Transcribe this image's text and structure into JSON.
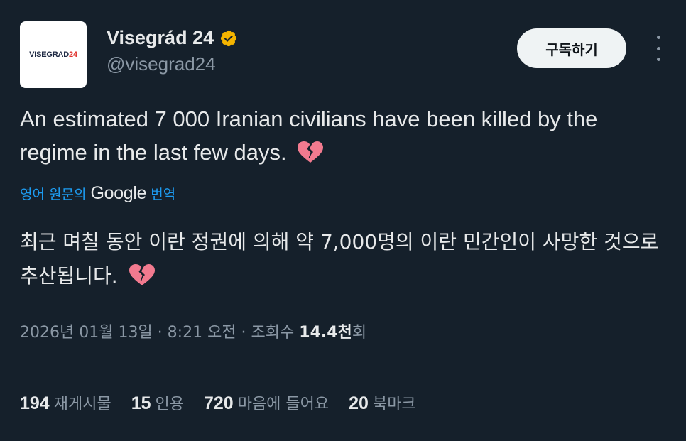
{
  "author": {
    "avatar_text_main": "VISEGRAD",
    "avatar_text_accent": "24",
    "display_name": "Visegrád 24",
    "handle": "@visegrad24",
    "verified_badge_color": "#f4b400"
  },
  "actions": {
    "subscribe_label": "구독하기",
    "more_icon": "more-vertical-icon"
  },
  "post": {
    "text_en": "An estimated 7 000 Iranian civilians have been killed by the regime in the last few days.",
    "emoji": "broken-heart-icon",
    "translation": {
      "prefix": "영어 원문의",
      "google": "Google",
      "suffix": "번역"
    },
    "text_ko": "최근 며칠 동안 이란 정권에 의해 약 7,000명의 이란 민간인이 사망한 것으로 추산됩니다."
  },
  "meta": {
    "date": "2026년 01월 13일",
    "sep1": " · ",
    "time": "8:21 오전",
    "sep2": " · ",
    "views_label": "조회수",
    "views_count": "14.4천",
    "views_suffix": "회"
  },
  "stats": {
    "reposts_count": "194",
    "reposts_label": "재게시물",
    "quotes_count": "15",
    "quotes_label": "인용",
    "likes_count": "720",
    "likes_label": "마음에 들어요",
    "bookmarks_count": "20",
    "bookmarks_label": "북마크"
  },
  "colors": {
    "background": "#15202b",
    "text_primary": "#e7e9ea",
    "text_secondary": "#8b98a5",
    "link": "#1d9bf0",
    "divider": "#38444d",
    "button_bg": "#eff3f4"
  }
}
